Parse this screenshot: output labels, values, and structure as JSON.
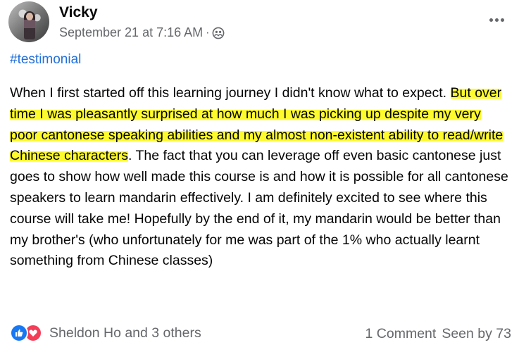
{
  "post": {
    "author": "Vicky",
    "timestamp": "September 21 at 7:16 AM",
    "separator": "·",
    "privacy_icon": "friends-icon",
    "menu_icon": "more-options-icon",
    "hashtag": "#testimonial",
    "body": {
      "part1": "When I first started off this learning journey I didn't know what to expect. ",
      "highlighted": "But over time I was pleasantly surprised at how much I was picking up despite my very poor cantonese speaking abilities and my almost non-existent ability to read/write Chinese characters",
      "part2": ". The fact that you can leverage off even basic cantonese just goes to show how well made this course is and how it is possible for all cantonese speakers to learn mandarin effectively. I am definitely excited to see where this course will take me! Hopefully by the end of it, my mandarin would be better than my brother's (who unfortunately for me was part of the 1% who actually learnt something from Chinese classes)"
    },
    "highlight_color": "#fdfa2e"
  },
  "footer": {
    "reaction_icons": [
      "like-icon",
      "love-icon"
    ],
    "reactors": "Sheldon Ho and 3 others",
    "comments": "1 Comment",
    "seen": "Seen by 73"
  },
  "colors": {
    "link": "#216fdb",
    "secondary_text": "#65676b",
    "like": "#1877f2",
    "love": "#f33e58"
  }
}
